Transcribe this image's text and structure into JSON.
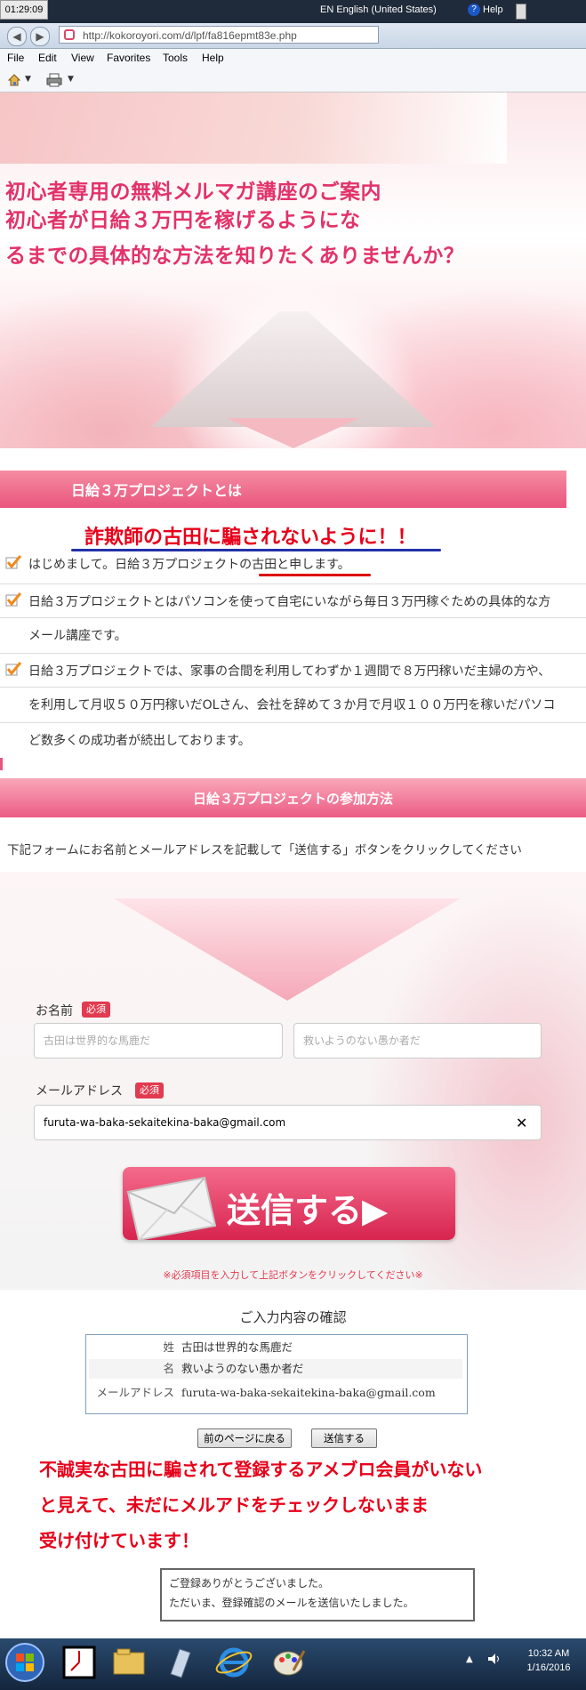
{
  "screen_clock": "01:29:09",
  "browser": {
    "url": "http://kokoroyori.com/d/lpf/fa816epmt83e.php",
    "language": "EN English (United States)",
    "help_label": "Help",
    "menu": [
      "File",
      "Edit",
      "View",
      "Favorites",
      "Tools",
      "Help"
    ]
  },
  "hero": {
    "lines": [
      "初心者専用の無料メルマガ講座のご案内",
      "初心者が日給３万円を稼げるようにな",
      "るまでの具体的な方法を知りたくありませんか？"
    ]
  },
  "section1": {
    "title": "日給３万プロジェクトとは",
    "annotation": "詐欺師の古田に騙されないように！！",
    "items": [
      "はじめまして。日給３万プロジェクトの古田と申します。",
      "日給３万プロジェクトとはパソコンを使って自宅にいながら毎日３万円稼ぐための具体的な方",
      "メール講座です。",
      "日給３万プロジェクトでは、家事の合間を利用してわずか１週間で８万円稼いだ主婦の方や、",
      "を利用して月収５０万円稼いだOLさん、会社を辞めて３か月で月収１００万円を稼いだパソコ",
      "ど数多くの成功者が続出しております。"
    ]
  },
  "section2": {
    "title": "日給３万プロジェクトの参加方法",
    "instruction": "下記フォームにお名前とメールアドレスを記載して「送信する」ボタンをクリックしてください"
  },
  "form": {
    "name_label": "お名前",
    "required_badge": "必須",
    "last_name_value": "古田は世界的な馬鹿だ",
    "first_name_value": "救いようのない愚か者だ",
    "email_label": "メールアドレス",
    "email_value": "furuta-wa-baka-sekaitekina-baka@gmail.com",
    "clear_glyph": "✕",
    "submit_label": "送信する▶",
    "note": "※必須項目を入力して上記ボタンをクリックしてください※"
  },
  "confirm": {
    "title": "ご入力内容の確認",
    "rows": [
      {
        "key": "姓",
        "value": "古田は世界的な馬鹿だ"
      },
      {
        "key": "名",
        "value": "救いようのない愚か者だ"
      },
      {
        "key": "メールアドレス",
        "value": "furuta-wa-baka-sekaitekina-baka@gmail.com"
      }
    ],
    "back_button": "前のページに戻る",
    "send_button": "送信する"
  },
  "annotation2": [
    "不誠実な古田に騙されて登録するアメブロ会員がいない",
    "と見えて、未だにメルアドをチェックしないまま",
    "受け付けています！"
  ],
  "thanks": [
    "ご登録ありがとうございました。",
    "ただいま、登録確認のメールを送信いたしました。"
  ],
  "taskbar": {
    "time": "10:32 AM",
    "date": "1/16/2016"
  },
  "colors": {
    "accent_pink": "#e9557d",
    "hero_text": "#e2326a",
    "annotation_red": "#e8001a"
  }
}
